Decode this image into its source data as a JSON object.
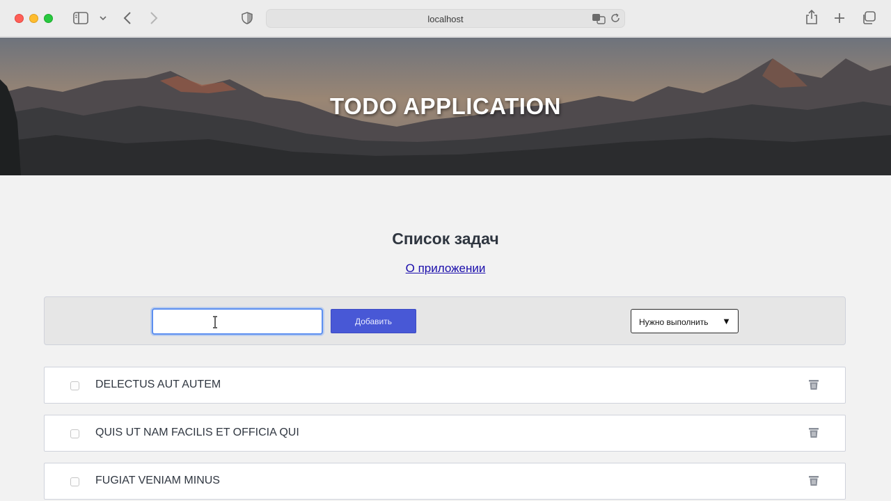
{
  "browser": {
    "url": "localhost"
  },
  "hero": {
    "title": "TODO APPLICATION"
  },
  "page": {
    "title": "Список задач",
    "about_link": "О приложении"
  },
  "controls": {
    "input_value": "",
    "add_label": "Добавить",
    "filter_selected": "Нужно выполнить"
  },
  "todos": [
    {
      "text": "DELECTUS AUT AUTEM",
      "done": false
    },
    {
      "text": "QUIS UT NAM FACILIS ET OFFICIA QUI",
      "done": false
    },
    {
      "text": "FUGIAT VENIAM MINUS",
      "done": false
    }
  ],
  "colors": {
    "accent": "#4858d6",
    "text": "#2f3640",
    "link": "#1a0dab"
  },
  "icons": [
    "sidebar-icon",
    "chevron-down-icon",
    "back-icon",
    "forward-icon",
    "shield-icon",
    "translate-icon",
    "reload-icon",
    "share-icon",
    "plus-icon",
    "tabs-icon",
    "text-cursor-icon",
    "trash-icon"
  ]
}
